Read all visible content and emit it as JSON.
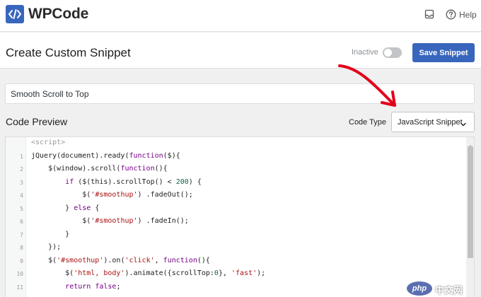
{
  "app": {
    "name": "WPCode",
    "help_label": "Help"
  },
  "header": {
    "title": "Create Custom Snippet",
    "status_label": "Inactive",
    "active": false,
    "save_label": "Save Snippet"
  },
  "snippet": {
    "title_value": "Smooth Scroll to Top"
  },
  "code_section": {
    "label": "Code Preview",
    "code_type_label": "Code Type",
    "code_type_value": "JavaScript Snippet"
  },
  "code_lines": [
    {
      "number": "",
      "text": "<script>"
    },
    {
      "number": "1",
      "text": "jQuery(document).ready(function($){"
    },
    {
      "number": "2",
      "text": "    $(window).scroll(function(){"
    },
    {
      "number": "3",
      "text": "        if ($(this).scrollTop() < 200) {"
    },
    {
      "number": "4",
      "text": "            $('#smoothup') .fadeOut();"
    },
    {
      "number": "5",
      "text": "        } else {"
    },
    {
      "number": "6",
      "text": "            $('#smoothup') .fadeIn();"
    },
    {
      "number": "7",
      "text": "        }"
    },
    {
      "number": "8",
      "text": "    });"
    },
    {
      "number": "9",
      "text": "    $('#smoothup').on('click', function(){"
    },
    {
      "number": "10",
      "text": "        $('html, body').animate({scrollTop:0}, 'fast');"
    },
    {
      "number": "11",
      "text": "        return false;"
    }
  ],
  "watermark": {
    "badge": "php",
    "text": "中文网"
  },
  "colors": {
    "accent": "#3866bd",
    "annotation": "#e3001b"
  }
}
